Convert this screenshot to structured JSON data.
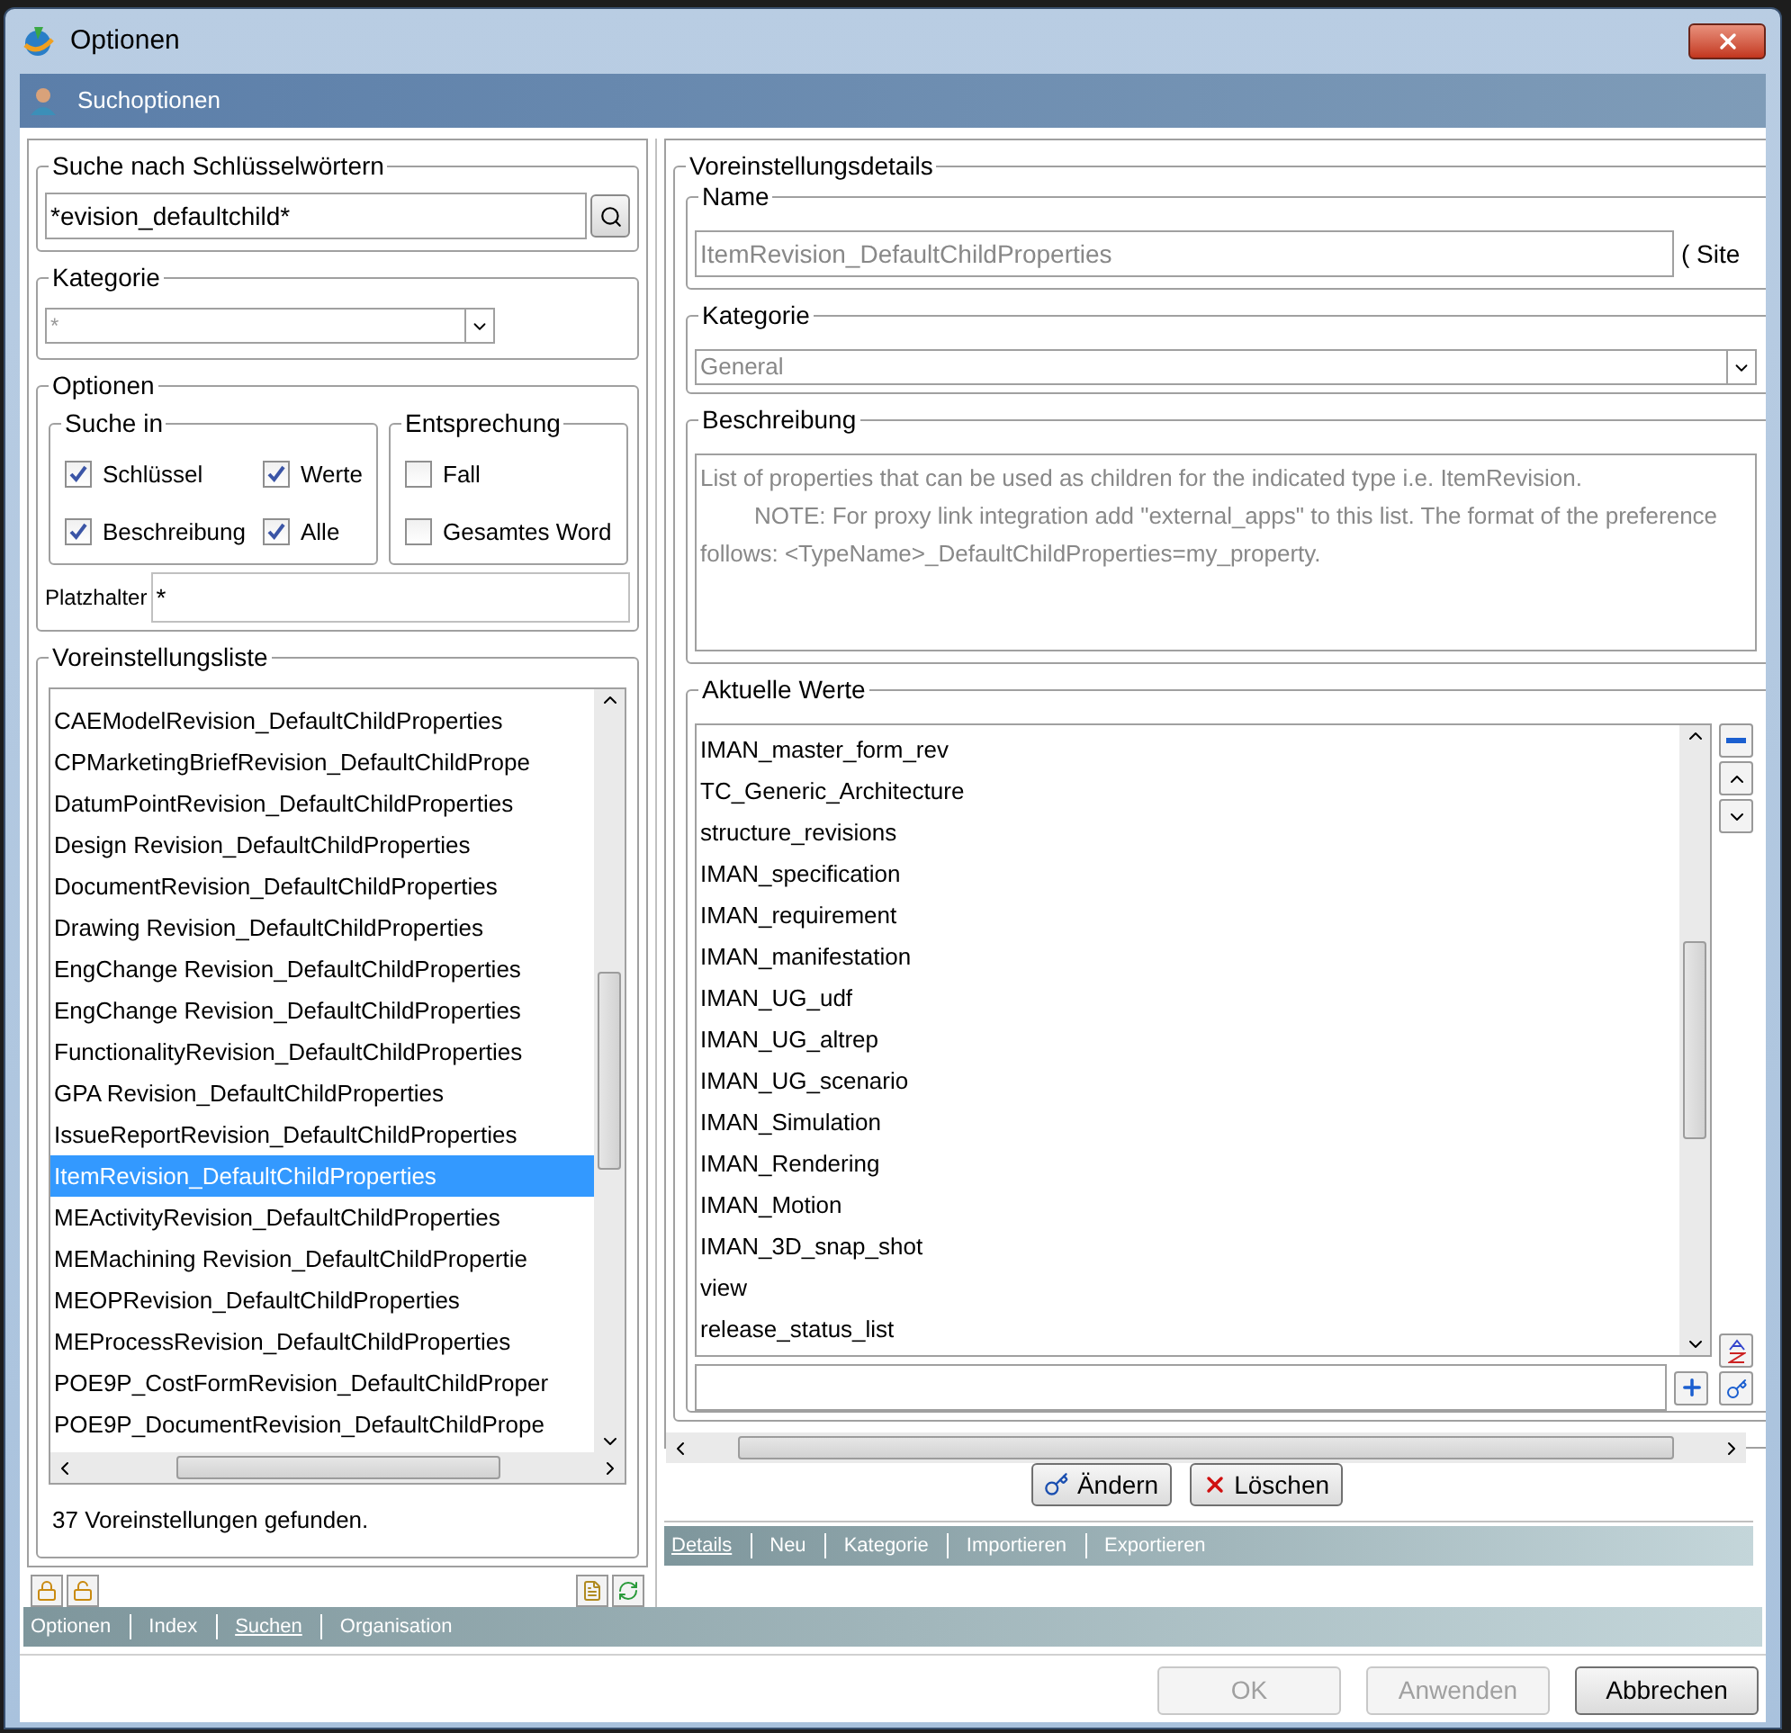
{
  "window": {
    "title": "Optionen"
  },
  "header": {
    "title": "Suchoptionen"
  },
  "keyword_search": {
    "legend": "Suche nach Schlüsselwörtern",
    "value": "*evision_defaultchild*"
  },
  "category": {
    "legend": "Kategorie",
    "value": "*"
  },
  "options": {
    "legend": "Optionen",
    "search_in": {
      "legend": "Suche in",
      "checkboxes": [
        {
          "label": "Schlüssel",
          "checked": true
        },
        {
          "label": "Werte",
          "checked": true
        },
        {
          "label": "Beschreibung",
          "checked": true
        },
        {
          "label": "Alle",
          "checked": true
        }
      ]
    },
    "match": {
      "legend": "Entsprechung",
      "checkboxes": [
        {
          "label": "Fall",
          "checked": false
        },
        {
          "label": "Gesamtes Word",
          "checked": false
        }
      ]
    },
    "wildcard": {
      "label": "Platzhalter",
      "value": "*"
    }
  },
  "preference_list": {
    "legend": "Voreinstellungsliste",
    "items": [
      {
        "label": "CAEModelRevision_DefaultChildProperties",
        "selected": false
      },
      {
        "label": "CPMarketingBriefRevision_DefaultChildPrope",
        "selected": false
      },
      {
        "label": "DatumPointRevision_DefaultChildProperties",
        "selected": false
      },
      {
        "label": "Design Revision_DefaultChildProperties",
        "selected": false
      },
      {
        "label": "DocumentRevision_DefaultChildProperties",
        "selected": false
      },
      {
        "label": "Drawing Revision_DefaultChildProperties",
        "selected": false
      },
      {
        "label": "EngChange Revision_DefaultChildProperties",
        "selected": false
      },
      {
        "label": "EngChange Revision_DefaultChildProperties",
        "selected": false
      },
      {
        "label": "FunctionalityRevision_DefaultChildProperties",
        "selected": false
      },
      {
        "label": "GPA Revision_DefaultChildProperties",
        "selected": false
      },
      {
        "label": "IssueReportRevision_DefaultChildProperties",
        "selected": false
      },
      {
        "label": "ItemRevision_DefaultChildProperties",
        "selected": true
      },
      {
        "label": "MEActivityRevision_DefaultChildProperties",
        "selected": false
      },
      {
        "label": "MEMachining Revision_DefaultChildPropertie",
        "selected": false
      },
      {
        "label": "MEOPRevision_DefaultChildProperties",
        "selected": false
      },
      {
        "label": "MEProcessRevision_DefaultChildProperties",
        "selected": false
      },
      {
        "label": "POE9P_CostFormRevision_DefaultChildProper",
        "selected": false
      },
      {
        "label": "POE9P_DocumentRevision_DefaultChildPrope",
        "selected": false
      }
    ],
    "count": "37 Voreinstellungen gefunden."
  },
  "details": {
    "legend": "Voreinstellungsdetails",
    "name": {
      "legend": "Name",
      "value": "ItemRevision_DefaultChildProperties",
      "read_only": true,
      "scope": "( Site"
    },
    "category": {
      "legend": "Kategorie",
      "value": "General",
      "read_only": true
    },
    "description": {
      "legend": "Beschreibung",
      "read_only": true,
      "lines": [
        "List of properties that can be used as children for the indicated type i.e. ItemRevision.",
        "NOTE: For proxy link integration add \"external_apps\" to this list. The format of the preference follows: <TypeName>_DefaultChildProperties=my_property."
      ]
    },
    "current_values": {
      "legend": "Aktuelle Werte",
      "values": [
        "IMAN_master_form_rev",
        "TC_Generic_Architecture",
        "structure_revisions",
        "IMAN_specification",
        "IMAN_requirement",
        "IMAN_manifestation",
        "IMAN_UG_udf",
        "IMAN_UG_altrep",
        "IMAN_UG_scenario",
        "IMAN_Simulation",
        "IMAN_Rendering",
        "IMAN_Motion",
        "IMAN_3D_snap_shot",
        "view",
        "release_status_list"
      ]
    },
    "buttons": [
      "Ändern",
      "Löschen"
    ],
    "tabs": [
      {
        "label": "Details",
        "selected": true
      },
      {
        "label": "Neu",
        "selected": false
      },
      {
        "label": "Kategorie",
        "selected": false
      },
      {
        "label": "Importieren",
        "selected": false
      },
      {
        "label": "Exportieren",
        "selected": false
      }
    ]
  },
  "tabs": [
    {
      "label": "Optionen",
      "selected": false
    },
    {
      "label": "Index",
      "selected": false
    },
    {
      "label": "Suchen",
      "selected": true
    },
    {
      "label": "Organisation",
      "selected": false
    }
  ],
  "footer_buttons": [
    {
      "label": "OK",
      "disabled": true
    },
    {
      "label": "Anwenden",
      "disabled": true
    },
    {
      "label": "Abbrechen",
      "disabled": false
    }
  ]
}
